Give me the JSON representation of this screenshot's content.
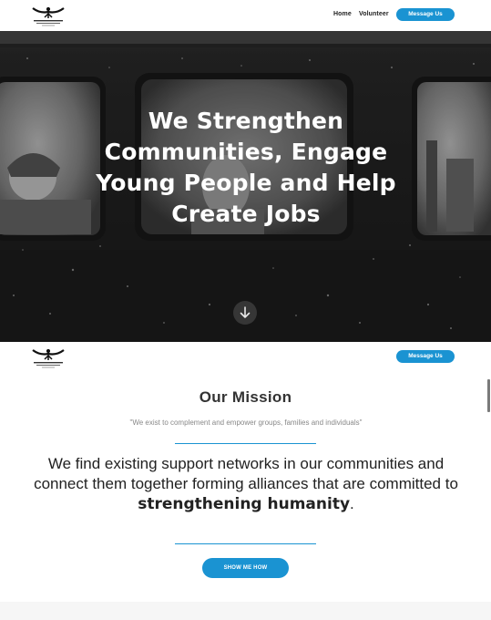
{
  "nav": {
    "home_label": "Home",
    "volunteer_label": "Volunteer",
    "message_label": "Message Us"
  },
  "hero": {
    "title": "We Strengthen Communities, Engage Young People and Help Create Jobs",
    "scroll_icon": "arrow-down-icon"
  },
  "subnav": {
    "message_label": "Message Us"
  },
  "mission": {
    "title": "Our Mission",
    "quote": "\"We exist to complement and empower groups, families and individuals\"",
    "body_text": "We find existing support networks in our communities and connect them together forming alliances that are committed to ",
    "body_emphasis": "strengthening humanity",
    "body_end": ".",
    "button_label": "SHOW ME HOW"
  },
  "colors": {
    "accent": "#1a93d2",
    "hero_overlay": "#222222",
    "text": "#222222",
    "muted": "#888888"
  }
}
